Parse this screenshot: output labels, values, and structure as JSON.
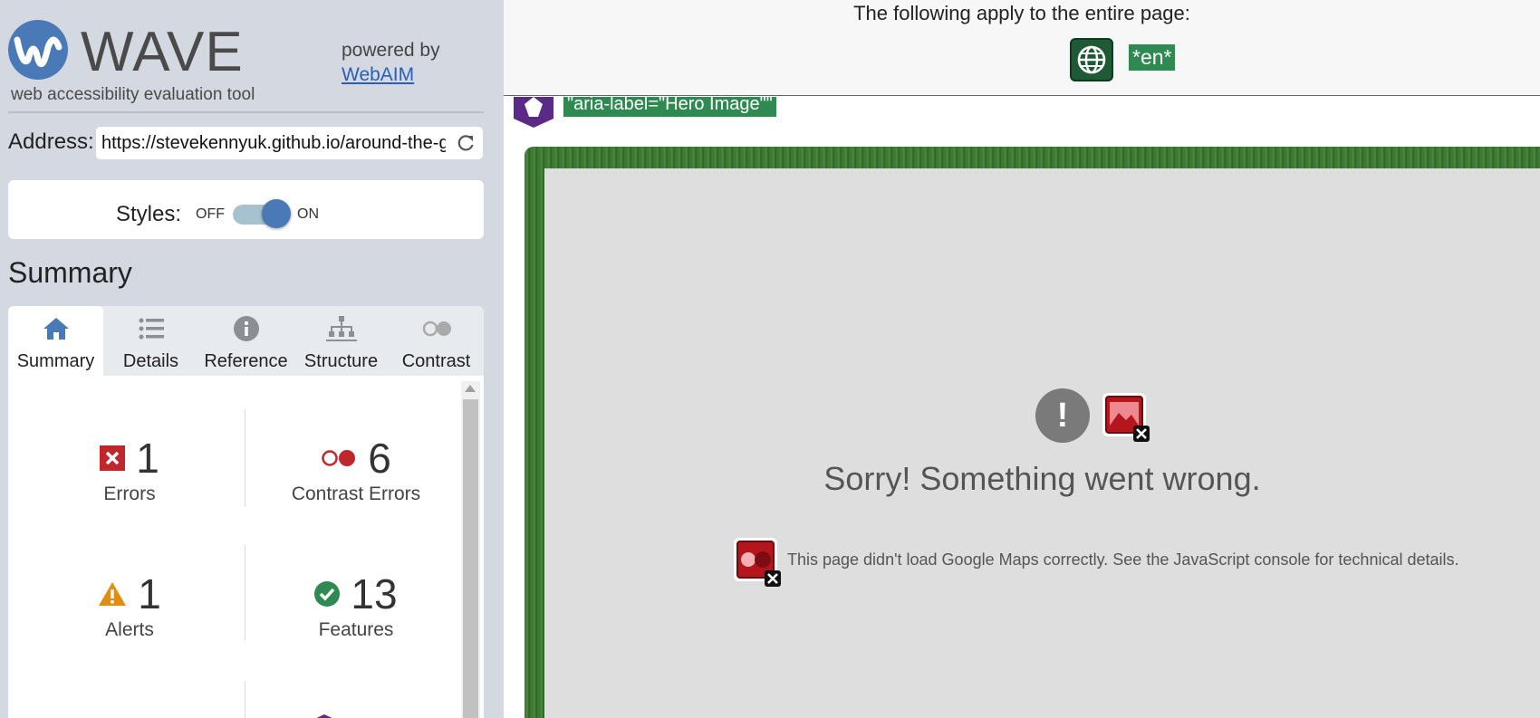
{
  "sidebar": {
    "logo_wordmark": "WAVE",
    "tagline": "web accessibility evaluation tool",
    "powered_by": "powered by",
    "webaim_link": "WebAIM",
    "address_label": "Address:",
    "address_value": "https://stevekennyuk.github.io/around-the-g",
    "styles_label": "Styles:",
    "styles_off": "OFF",
    "styles_on": "ON",
    "summary_heading": "Summary",
    "tabs": [
      {
        "label": "Summary",
        "icon": "home-icon",
        "active": true
      },
      {
        "label": "Details",
        "icon": "list-icon",
        "active": false
      },
      {
        "label": "Reference",
        "icon": "info-icon",
        "active": false
      },
      {
        "label": "Structure",
        "icon": "sitemap-icon",
        "active": false
      },
      {
        "label": "Contrast",
        "icon": "contrast-icon",
        "active": false
      }
    ],
    "stats": {
      "errors": {
        "count": "1",
        "label": "Errors"
      },
      "contrast_errors": {
        "count": "6",
        "label": "Contrast Errors"
      },
      "alerts": {
        "count": "1",
        "label": "Alerts"
      },
      "features": {
        "count": "13",
        "label": "Features"
      }
    }
  },
  "page": {
    "header_text": "The following apply to the entire page:",
    "lang_tag": "*en*",
    "aria_tag": "\"aria-label=\"Hero Image\"\"",
    "map_error_title": "Sorry! Something went wrong.",
    "map_error_detail": "This page didn't load Google Maps correctly. See the JavaScript console for technical details."
  },
  "colors": {
    "sidebar_bg": "#d4d9e1",
    "accent_blue": "#4a79b8",
    "error_red": "#c0272d",
    "alert_orange": "#e38b13",
    "feature_green": "#2f8a52",
    "aria_purple": "#5b2a86"
  }
}
